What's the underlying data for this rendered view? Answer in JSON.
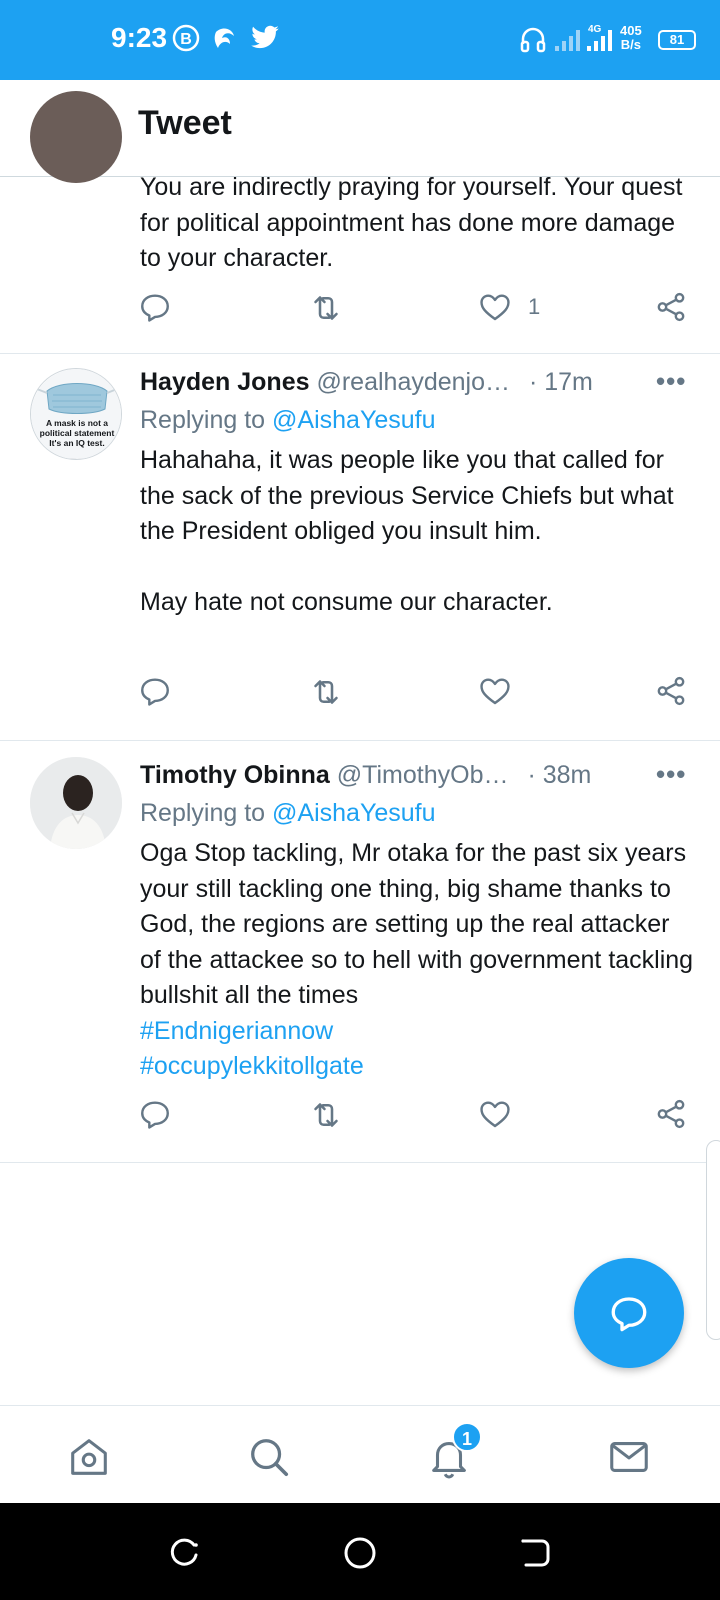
{
  "status_bar": {
    "time": "9:23",
    "net_speed_value": "405",
    "net_speed_unit": "B/s",
    "network_type": "4G",
    "battery": "81",
    "bg_color": "#1da1f2"
  },
  "header": {
    "title": "Tweet",
    "back_icon": "arrow-left-icon"
  },
  "tweets": [
    {
      "name": "",
      "handle": "",
      "time": "",
      "replying_label": "",
      "mention": "",
      "text": "You are indirectly praying for yourself. Your quest for political appointment has done more damage to your character.",
      "hashtags": [],
      "like_count": "1"
    },
    {
      "name": "Hayden Jones",
      "handle": "@realhaydenjo…",
      "time": "· 17m",
      "replying_label": "Replying to ",
      "mention": "@AishaYesufu",
      "text": "Hahahaha, it was people like you that called for the sack of the previous Service Chiefs but what the President obliged you insult him.\n\nMay hate not consume our character.",
      "hashtags": [],
      "like_count": "",
      "avatar_caption": [
        "A mask is not a",
        "political statement",
        "It's an IQ test."
      ]
    },
    {
      "name": "Timothy Obinna",
      "handle": "@TimothyOb…",
      "time": "· 38m",
      "replying_label": "Replying to ",
      "mention": "@AishaYesufu",
      "text": "Oga Stop tackling, Mr otaka for the past six years your still tackling one thing, big shame thanks to God, the regions are setting up the real attacker of the attackee so to hell with government tackling bullshit all the times",
      "hashtags": [
        "#Endnigeriannow",
        "#occupylekkitollgate"
      ],
      "like_count": ""
    }
  ],
  "bottom_nav": {
    "items": [
      "home-icon",
      "search-icon",
      "notifications-icon",
      "messages-icon"
    ],
    "notification_badge": "1"
  },
  "fab": {
    "icon": "compose-reply-icon"
  },
  "colors": {
    "accent": "#1da1f2",
    "secondary_text": "#657786",
    "primary_text": "#14171a"
  }
}
